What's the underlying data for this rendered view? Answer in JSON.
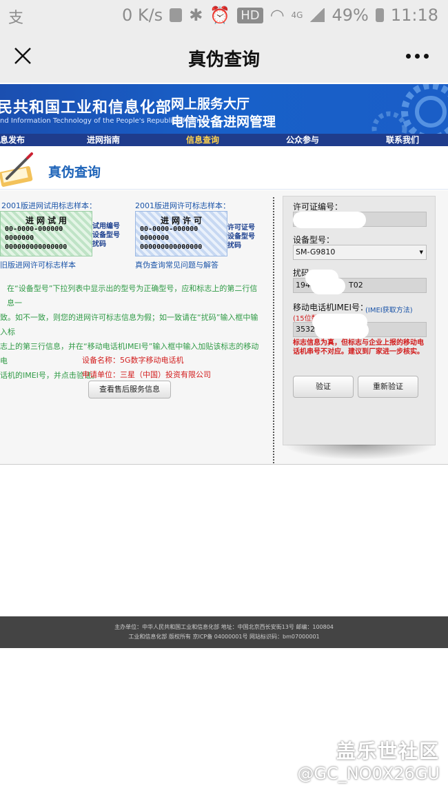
{
  "status_bar": {
    "left_icon": "支",
    "speed": "0 K/s",
    "hd": "HD",
    "network": "4G",
    "battery": "49%",
    "time": "11:18"
  },
  "nav": {
    "title": "真伪查询"
  },
  "banner": {
    "ministry": "民共和国工业和信息化部",
    "ministry_en": "nd Information Technology of the People's Republic of China",
    "hall": "网上服务大厅",
    "mgmt": "电信设备进网管理"
  },
  "menu": [
    {
      "label": "息发布"
    },
    {
      "label": "进网指南"
    },
    {
      "label": "信息查询"
    },
    {
      "label": "公众参与"
    },
    {
      "label": "联系我们"
    }
  ],
  "section": {
    "title": "真伪查询"
  },
  "samples": {
    "trial_label": "2001版进网试用标志样本：",
    "permit_label": "2001版进网许可标志样本：",
    "trial_head": "进网试用",
    "permit_head": "进网许可",
    "code1": "00-0000-000000",
    "code2": "0000000",
    "code3": "000000000000000",
    "trial_side": [
      "试用编号",
      "设备型号",
      "扰码"
    ],
    "permit_side": [
      "许可证号",
      "设备型号",
      "扰码"
    ],
    "old_link": "旧版进网许可标志样本",
    "faq_link": "真伪查询常见问题与解答"
  },
  "instructions": [
    "在“设备型号”下拉列表中显示出的型号为正确型号，应和标志上的第二行信息一",
    "致。如不一致，则您的进网许可标志信息为假；如一致请在“扰码”输入框中输入标",
    "志上的第三行信息，并在“移动电话机IMEI号”输入框中输入加贴该标志的移动电",
    "话机的IMEI号，并点击验证。"
  ],
  "device_info": {
    "name": "设备名称：5G数字移动电话机",
    "applicant": "申请单位：三星（中国）投资有限公司",
    "service_button": "查看售后服务信息"
  },
  "form": {
    "license_label": "许可证编号：",
    "license_value": "",
    "model_label": "设备型号：",
    "model_value": "SM-G9810",
    "scramble_label": "扰码：",
    "scramble_left": "194",
    "scramble_right": "T02",
    "imei_label": "移动电话机IMEI号：",
    "imei_link": "(IMEI获取方法)",
    "imei_hint": "(15位数字",
    "imei_value": "35324",
    "warning": "标志信息为真，但标志与企业上报的移动电话机串号不对应。建议到厂家进一步核实。",
    "verify_button": "验证",
    "reverify_button": "重新验证"
  },
  "footer": {
    "line1": "主办单位：中华人民共和国工业和信息化部 地址：中国北京西长安街13号 邮编：100804",
    "line2": "工业和信息化部 版权所有 京ICP备 04000001号 网站标识码：bm07000001"
  },
  "watermark": {
    "brand": "盖乐世社区",
    "handle": "@GC_NO0X26GU"
  }
}
